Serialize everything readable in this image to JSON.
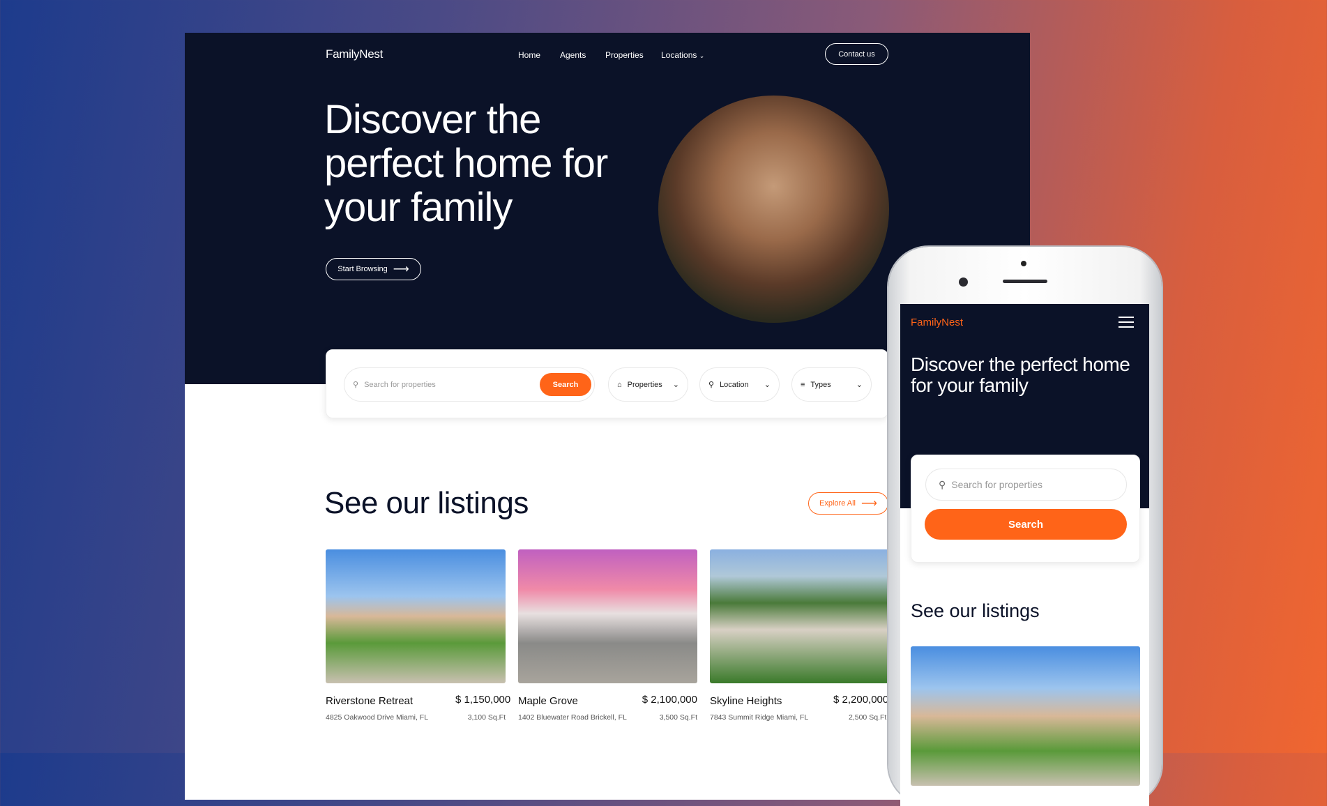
{
  "brand": "FamilyNest",
  "nav": {
    "items": [
      "Home",
      "Agents",
      "Properties",
      "Locations"
    ],
    "contact": "Contact us"
  },
  "hero": {
    "line1": "Discover the",
    "line2": "perfect home for",
    "line3": "your family",
    "cta": "Start Browsing"
  },
  "search": {
    "placeholder": "Search for properties",
    "button": "Search",
    "filters": [
      "Properties",
      "Location",
      "Types"
    ]
  },
  "listings": {
    "title": "See our listings",
    "explore": "Explore All",
    "items": [
      {
        "name": "Riverstone Retreat",
        "price": "$ 1,150,000",
        "address": "4825 Oakwood Drive Miami, FL",
        "size": "3,100 Sq.Ft"
      },
      {
        "name": "Maple Grove",
        "price": "$ 2,100,000",
        "address": "1402 Bluewater Road Brickell, FL",
        "size": "3,500 Sq.Ft"
      },
      {
        "name": "Skyline Heights",
        "price": "$ 2,200,000",
        "address": "7843 Summit Ridge Miami, FL",
        "size": "2,500 Sq.Ft"
      }
    ]
  },
  "mobile": {
    "brand": "FamilyNest",
    "heading1": "Discover the perfect home",
    "heading2": "for your family",
    "placeholder": "Search for properties",
    "button": "Search",
    "listings_title": "See our listings"
  },
  "colors": {
    "navy": "#0b1228",
    "accent": "#ff6418"
  }
}
